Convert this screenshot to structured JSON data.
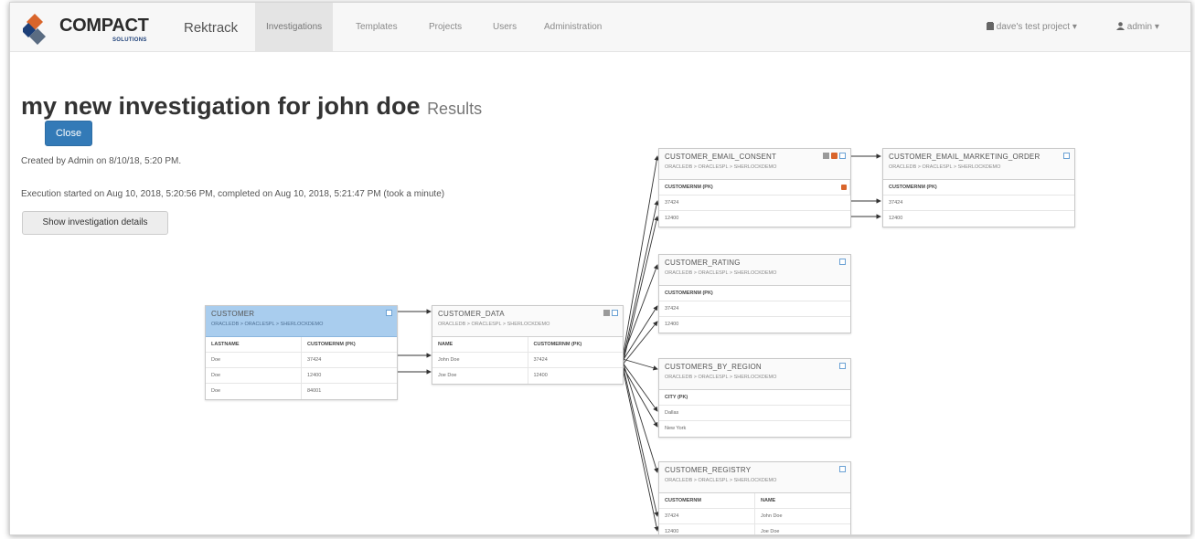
{
  "nav": {
    "logo_text": "COMPACT",
    "logo_sub": "SOLUTIONS",
    "brand": "Rektrack",
    "items": [
      "Investigations",
      "Templates",
      "Projects",
      "Users",
      "Administration"
    ],
    "project": "dave's test project",
    "user": "admin"
  },
  "page": {
    "title": "my new investigation for john doe",
    "subtitle": "Results",
    "close_label": "Close",
    "created": "Created by Admin on 8/10/18, 5:20 PM.",
    "execution": "Execution started on Aug 10, 2018, 5:20:56 PM, completed on Aug 10, 2018, 5:21:47 PM (took a minute)",
    "details_label": "Show investigation details"
  },
  "tables": {
    "customer": {
      "name": "CUSTOMER",
      "path": "ORACLEDB > ORACLESPL > SHERLOCKDEMO",
      "columns": [
        "LASTNAME",
        "CUSTOMERNM (PK)"
      ],
      "rows": [
        [
          "Doe",
          "37424"
        ],
        [
          "Doe",
          "12400"
        ],
        [
          "Doe",
          "84001"
        ]
      ]
    },
    "customer_data": {
      "name": "CUSTOMER_DATA",
      "path": "ORACLEDB > ORACLESPL > SHERLOCKDEMO",
      "columns": [
        "NAME",
        "CUSTOMERNM (PK)"
      ],
      "rows": [
        [
          "John Doe",
          "37424"
        ],
        [
          "Joe Doe",
          "12400"
        ]
      ]
    },
    "email_consent": {
      "name": "CUSTOMER_EMAIL_CONSENT",
      "path": "ORACLEDB > ORACLESPL > SHERLOCKDEMO",
      "columns": [
        "CUSTOMERNM (PK)"
      ],
      "rows": [
        [
          "37424"
        ],
        [
          "12400"
        ]
      ]
    },
    "email_marketing": {
      "name": "CUSTOMER_EMAIL_MARKETING_ORDER",
      "path": "ORACLEDB > ORACLESPL > SHERLOCKDEMO",
      "columns": [
        "CUSTOMERNM (PK)"
      ],
      "rows": [
        [
          "37424"
        ],
        [
          "12400"
        ]
      ]
    },
    "rating": {
      "name": "CUSTOMER_RATING",
      "path": "ORACLEDB > ORACLESPL > SHERLOCKDEMO",
      "columns": [
        "CUSTOMERNM (PK)"
      ],
      "rows": [
        [
          "37424"
        ],
        [
          "12400"
        ]
      ]
    },
    "by_region": {
      "name": "CUSTOMERS_BY_REGION",
      "path": "ORACLEDB > ORACLESPL > SHERLOCKDEMO",
      "columns": [
        "CITY (PK)"
      ],
      "rows": [
        [
          "Dallas"
        ],
        [
          "New York"
        ]
      ]
    },
    "registry": {
      "name": "CUSTOMER_REGISTRY",
      "path": "ORACLEDB > ORACLESPL > SHERLOCKDEMO",
      "columns": [
        "CUSTOMERNM",
        "NAME"
      ],
      "rows": [
        [
          "37424",
          "John Doe"
        ],
        [
          "12400",
          "Joe Doe"
        ]
      ]
    }
  },
  "colors": {
    "primary": "#337ab7",
    "selected_header": "#a9cdee",
    "lock": "#d9652b"
  }
}
